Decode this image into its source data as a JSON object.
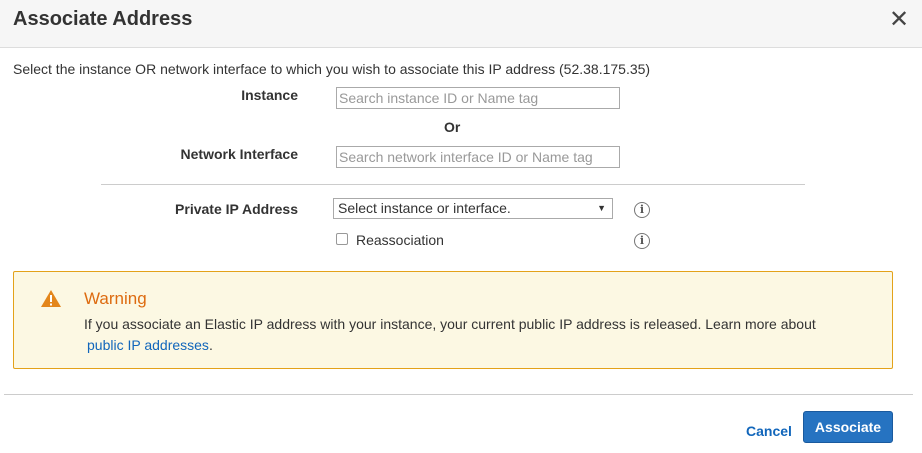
{
  "dialog": {
    "title": "Associate Address",
    "close_glyph": "✕"
  },
  "form": {
    "intro": "Select the instance OR network interface to which you wish to associate this IP address (52.38.175.35)",
    "instance_label": "Instance",
    "instance_placeholder": "Search instance ID or Name tag",
    "instance_value": "",
    "or_text": "Or",
    "network_interface_label": "Network Interface",
    "network_interface_placeholder": "Search network interface ID or Name tag",
    "network_interface_value": "",
    "private_ip_label": "Private IP Address",
    "private_ip_selected": "Select instance or interface.",
    "reassociation_label": "Reassociation",
    "reassociation_checked": false,
    "info_glyph": "i"
  },
  "warning": {
    "title": "Warning",
    "message": "If you associate an Elastic IP address with your instance, your current public IP address is released. Learn more about",
    "link_text": "public IP addresses",
    "after_link": ".",
    "color": "#dd6b10"
  },
  "footer": {
    "cancel_label": "Cancel",
    "associate_label": "Associate",
    "accent": "#2673c1"
  }
}
